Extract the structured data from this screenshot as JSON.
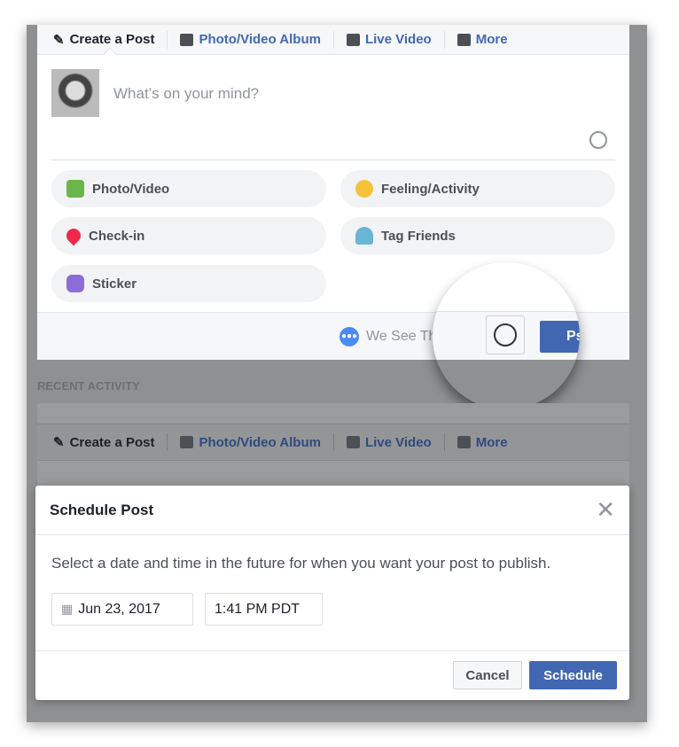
{
  "composer": {
    "tabs": [
      {
        "label": "Create a Post",
        "icon": "pencil-icon"
      },
      {
        "label": "Photo/Video Album",
        "icon": "album-icon"
      },
      {
        "label": "Live Video",
        "icon": "video-camera-icon"
      },
      {
        "label": "More",
        "icon": "more-icon"
      }
    ],
    "placeholder": "What’s on your mind?",
    "actions": [
      {
        "label": "Photo/Video",
        "color": "#6bb64a"
      },
      {
        "label": "Feeling/Activity",
        "color": "#f5c33b"
      },
      {
        "label": "Check-in",
        "color": "#f02849"
      },
      {
        "label": "Tag Friends",
        "color": "#6ab4d6"
      },
      {
        "label": "Sticker",
        "color": "#8c6cd6"
      }
    ],
    "audience": "We See Thrld",
    "post_label": "Pst"
  },
  "recent_activity": "RECENT ACTIVITY",
  "modal": {
    "title": "Schedule Post",
    "description": "Select a date and time in the future for when you want your post to publish.",
    "date": "Jun 23, 2017",
    "time": "1:41 PM PDT",
    "cancel": "Cancel",
    "schedule": "Schedule"
  },
  "colors": {
    "accent": "#4267b2",
    "overlay": "#8f9092"
  }
}
